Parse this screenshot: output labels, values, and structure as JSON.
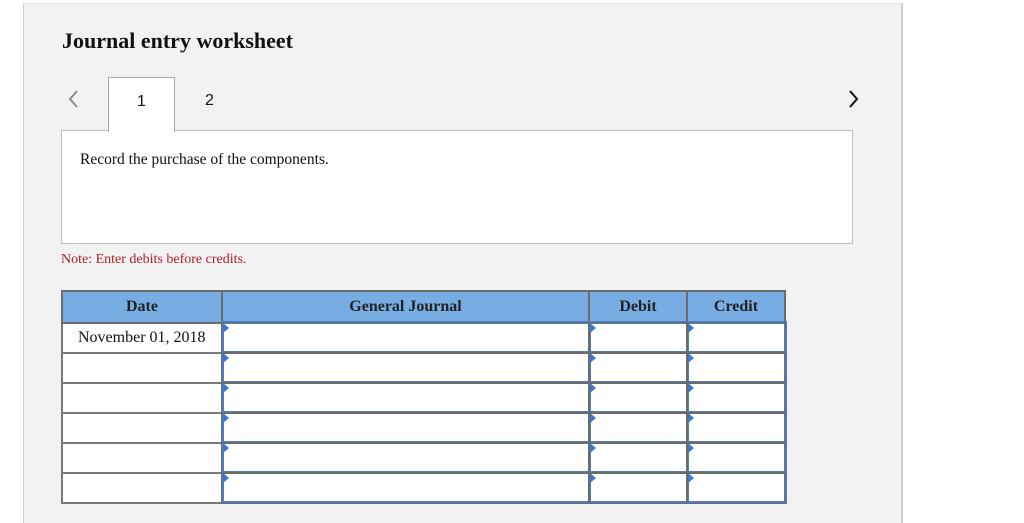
{
  "title": "Journal entry worksheet",
  "navigation": {
    "prev_icon": "chevron-left-icon",
    "next_icon": "chevron-right-icon",
    "tabs": [
      {
        "label": "1",
        "active": true
      },
      {
        "label": "2",
        "active": false
      }
    ]
  },
  "instruction": "Record the purchase of the components.",
  "note": "Note: Enter debits before credits.",
  "table": {
    "headers": [
      "Date",
      "General Journal",
      "Debit",
      "Credit"
    ],
    "rows": [
      {
        "date": "November 01, 2018",
        "general_journal": "",
        "debit": "",
        "credit": ""
      },
      {
        "date": "",
        "general_journal": "",
        "debit": "",
        "credit": ""
      },
      {
        "date": "",
        "general_journal": "",
        "debit": "",
        "credit": ""
      },
      {
        "date": "",
        "general_journal": "",
        "debit": "",
        "credit": ""
      },
      {
        "date": "",
        "general_journal": "",
        "debit": "",
        "credit": ""
      },
      {
        "date": "",
        "general_journal": "",
        "debit": "",
        "credit": ""
      }
    ]
  },
  "colors": {
    "header_bg": "#78ade3",
    "note_text": "#b0202a",
    "entry_border": "#4f7fbd",
    "panel_bg": "#f2f2f2"
  }
}
